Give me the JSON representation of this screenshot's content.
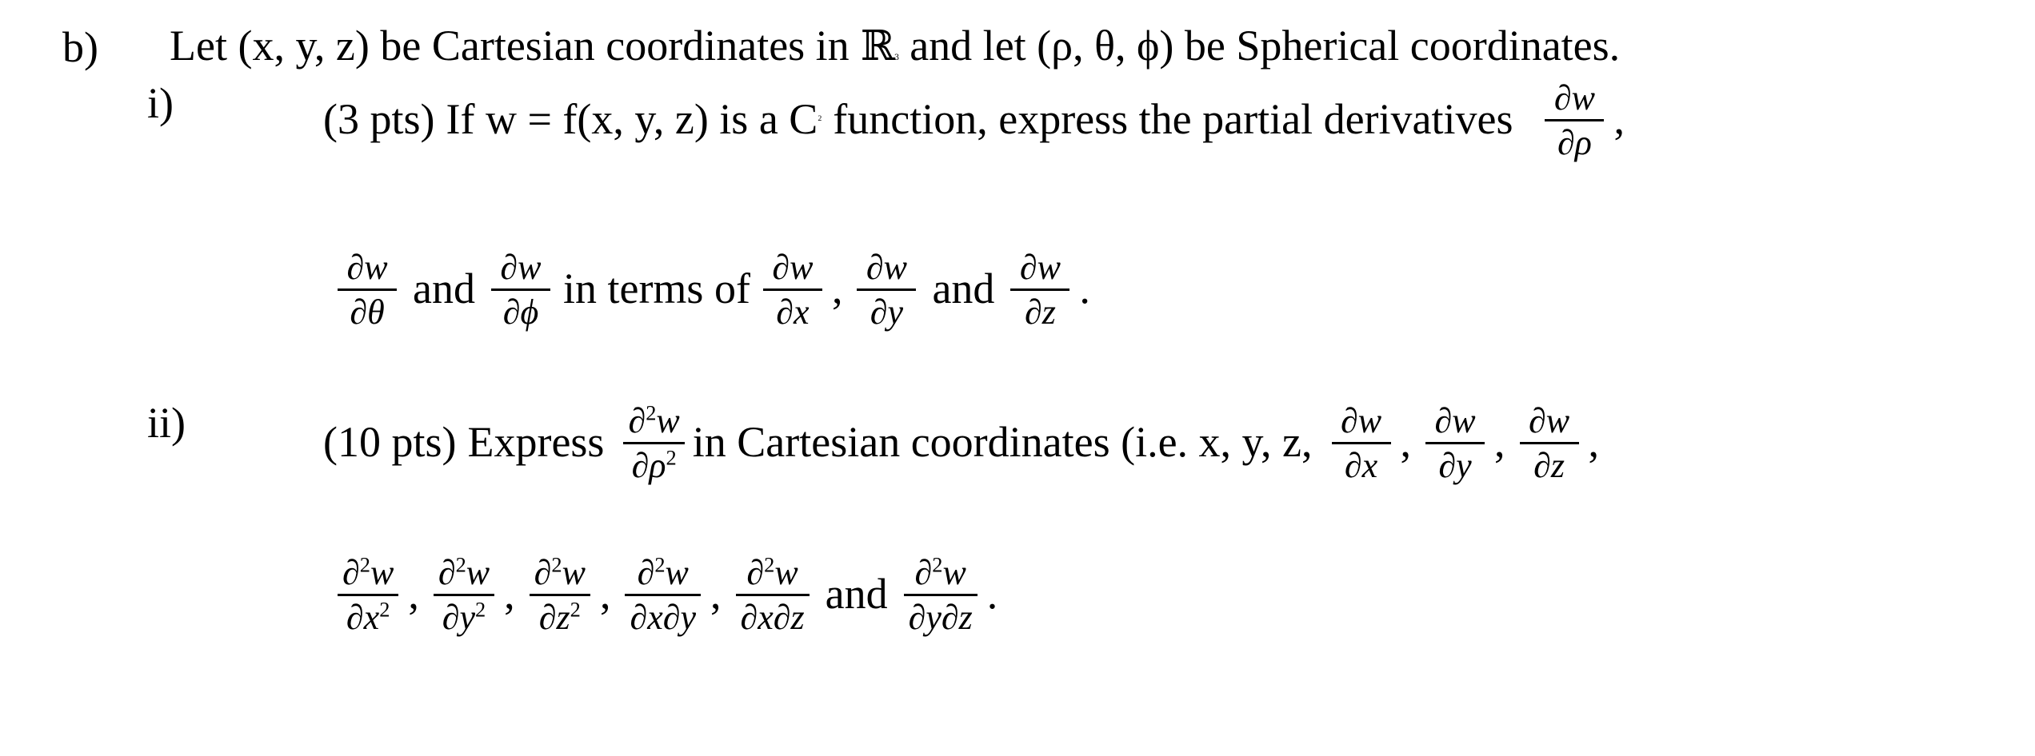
{
  "document": {
    "type": "math-exam-question",
    "part_label": "b)",
    "intro": {
      "text_1": "Let (x, y, z) be Cartesian coordinates in",
      "symbol_R": "ℝ",
      "symbol_R_exponent": "3",
      "text_2": "and let (ρ, θ, ϕ) be Spherical coordinates."
    },
    "subparts": [
      {
        "label": "i)",
        "points": "(3 pts)",
        "line1_text_a": "If w = f(x, y, z) is a C",
        "line1_exponent": "2",
        "line1_text_b": "function, express the partial derivatives",
        "line1_frac": {
          "num_partial": "∂",
          "num_var": "w",
          "den_partial": "∂",
          "den_var": "ρ",
          "trailing": ","
        },
        "line2": {
          "frac_1": {
            "num_partial": "∂",
            "num_var": "w",
            "den_partial": "∂",
            "den_var": "θ"
          },
          "word_and_1": "and",
          "frac_2": {
            "num_partial": "∂",
            "num_var": "w",
            "den_partial": "∂",
            "den_var": "ϕ"
          },
          "words_in_terms_of": "in terms of",
          "frac_3": {
            "num_partial": "∂",
            "num_var": "w",
            "den_partial": "∂",
            "den_var": "x",
            "trailing": ","
          },
          "frac_4": {
            "num_partial": "∂",
            "num_var": "w",
            "den_partial": "∂",
            "den_var": "y"
          },
          "word_and_2": "and",
          "frac_5": {
            "num_partial": "∂",
            "num_var": "w",
            "den_partial": "∂",
            "den_var": "z",
            "trailing": "."
          }
        }
      },
      {
        "label": "ii)",
        "points": "(10 pts)",
        "line1_verb": "Express",
        "line1_frac": {
          "num_partial": "∂",
          "num_exp": "2",
          "num_var": "w",
          "den_partial": "∂",
          "den_var": "ρ",
          "den_exp": "2"
        },
        "line1_text": "in Cartesian coordinates (i.e. x, y, z,",
        "line1_fracs": [
          {
            "num_partial": "∂",
            "num_var": "w",
            "den_partial": "∂",
            "den_var": "x",
            "trailing": ","
          },
          {
            "num_partial": "∂",
            "num_var": "w",
            "den_partial": "∂",
            "den_var": "y",
            "trailing": ","
          },
          {
            "num_partial": "∂",
            "num_var": "w",
            "den_partial": "∂",
            "den_var": "z",
            "trailing": ","
          }
        ],
        "line2_fracs": [
          {
            "num_partial": "∂",
            "num_exp": "2",
            "num_var": "w",
            "den_partial": "∂",
            "den_var": "x",
            "den_exp": "2",
            "trailing": ","
          },
          {
            "num_partial": "∂",
            "num_exp": "2",
            "num_var": "w",
            "den_partial": "∂",
            "den_var": "y",
            "den_exp": "2",
            "trailing": ","
          },
          {
            "num_partial": "∂",
            "num_exp": "2",
            "num_var": "w",
            "den_partial": "∂",
            "den_var": "z",
            "den_exp": "2",
            "trailing": ","
          },
          {
            "num_partial": "∂",
            "num_exp": "2",
            "num_var": "w",
            "den_partial": "∂",
            "den_var": "x∂y",
            "trailing": ","
          },
          {
            "num_partial": "∂",
            "num_exp": "2",
            "num_var": "w",
            "den_partial": "∂",
            "den_var": "x∂z"
          }
        ],
        "line2_word_and": "and",
        "line2_frac_last": {
          "num_partial": "∂",
          "num_exp": "2",
          "num_var": "w",
          "den_partial": "∂",
          "den_var": "y∂z",
          "trailing": "."
        }
      }
    ]
  }
}
